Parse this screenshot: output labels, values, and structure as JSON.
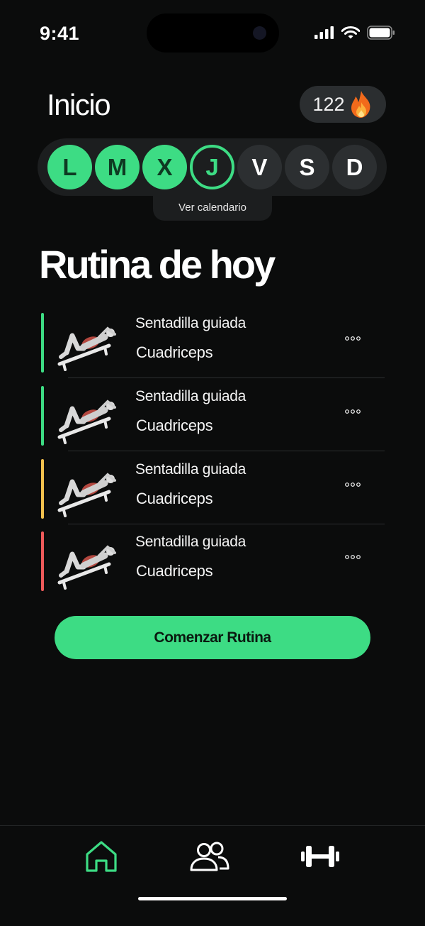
{
  "status_bar": {
    "time": "9:41"
  },
  "header": {
    "title": "Inicio",
    "streak_count": "122",
    "streak_icon": "flame-icon"
  },
  "week": {
    "days": [
      {
        "letter": "L",
        "state": "done"
      },
      {
        "letter": "M",
        "state": "done"
      },
      {
        "letter": "X",
        "state": "done"
      },
      {
        "letter": "J",
        "state": "today"
      },
      {
        "letter": "V",
        "state": "future"
      },
      {
        "letter": "S",
        "state": "future"
      },
      {
        "letter": "D",
        "state": "future"
      }
    ],
    "calendar_link": "Ver calendario"
  },
  "routine": {
    "title": "Rutina de hoy",
    "exercises": [
      {
        "name": "Sentadilla guiada",
        "muscle": "Cuadriceps",
        "accent": "#3ddc84"
      },
      {
        "name": "Sentadilla guiada",
        "muscle": "Cuadriceps",
        "accent": "#3ddc84"
      },
      {
        "name": "Sentadilla guiada",
        "muscle": "Cuadriceps",
        "accent": "#f2c14e"
      },
      {
        "name": "Sentadilla guiada",
        "muscle": "Cuadriceps",
        "accent": "#ee5a5a"
      }
    ],
    "start_label": "Comenzar Rutina"
  },
  "tab_bar": {
    "items": [
      {
        "icon": "home-icon",
        "active": true
      },
      {
        "icon": "users-icon",
        "active": false
      },
      {
        "icon": "dumbbell-icon",
        "active": false
      }
    ]
  },
  "colors": {
    "accent": "#3ddc84",
    "background": "#0b0c0c"
  }
}
